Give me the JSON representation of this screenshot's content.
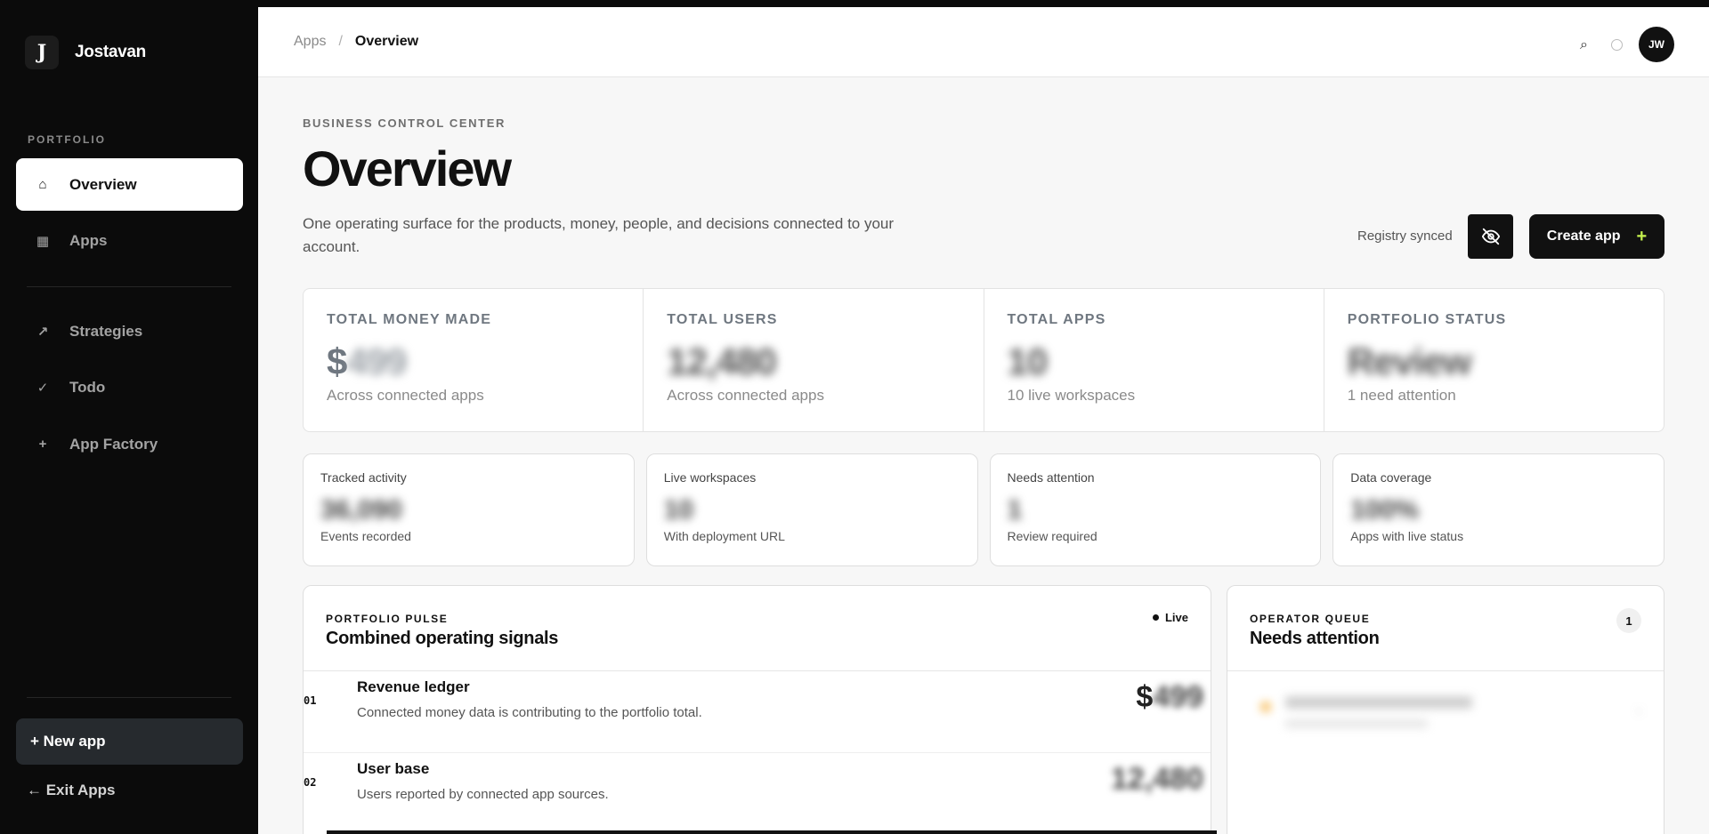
{
  "app": {
    "name": "Jostavan",
    "logo_letter": "J"
  },
  "sidebar": {
    "section_label": "PORTFOLIO",
    "items": [
      {
        "label": "Overview",
        "icon": "home-icon",
        "glyph": "⌂",
        "active": true
      },
      {
        "label": "Apps",
        "icon": "grid-icon",
        "glyph": "▦",
        "active": false
      },
      {
        "label": "Strategies",
        "icon": "trend-arrow-icon",
        "glyph": "↗",
        "active": false
      },
      {
        "label": "Todo",
        "icon": "check-icon",
        "glyph": "✓",
        "active": false
      },
      {
        "label": "App Factory",
        "icon": "plus-icon",
        "glyph": "+",
        "active": false
      }
    ],
    "new_app_label": "+ New app",
    "exit_label": "← Exit Apps"
  },
  "header": {
    "breadcrumb": {
      "parent": "Apps",
      "separator": "/",
      "current": "Overview"
    },
    "avatar_initials": "JW"
  },
  "main": {
    "eyebrow": "BUSINESS CONTROL CENTER",
    "title": "Overview",
    "subtitle": "One operating surface for the products, money, people, and decisions connected to your account.",
    "sync_status": "Registry synced",
    "create_label": "Create app",
    "create_plus": "+",
    "stats": [
      {
        "label": "TOTAL MONEY MADE",
        "prefix": "$",
        "value": "499",
        "sub": "Across connected apps"
      },
      {
        "label": "TOTAL USERS",
        "value": "12,480",
        "sub": "Across connected apps"
      },
      {
        "label": "TOTAL APPS",
        "value": "10",
        "sub": "10 live workspaces"
      },
      {
        "label": "PORTFOLIO STATUS",
        "value": "Review",
        "sub": "1 need attention"
      }
    ],
    "metrics": [
      {
        "label": "Tracked activity",
        "value": "36,090",
        "sub": "Events recorded"
      },
      {
        "label": "Live workspaces",
        "value": "10",
        "sub": "With deployment URL"
      },
      {
        "label": "Needs attention",
        "value": "1",
        "sub": "Review required"
      },
      {
        "label": "Data coverage",
        "value": "100%",
        "sub": "Apps with live status"
      }
    ],
    "pulse": {
      "eyebrow": "PORTFOLIO PULSE",
      "title": "Combined operating signals",
      "live_label": "Live",
      "rows": [
        {
          "num": "01",
          "title": "Revenue ledger",
          "desc": "Connected money data is contributing to the portfolio total.",
          "prefix": "$",
          "value": "499"
        },
        {
          "num": "02",
          "title": "User base",
          "desc": "Users reported by connected app sources.",
          "prefix": "",
          "value": "12,480"
        }
      ]
    },
    "queue": {
      "eyebrow": "OPERATOR QUEUE",
      "title": "Needs attention",
      "count": "1",
      "status_color": "#f5a623"
    }
  },
  "colors": {
    "sidebar_bg": "#0b0b0b",
    "accent_plus": "#c6f24e"
  }
}
